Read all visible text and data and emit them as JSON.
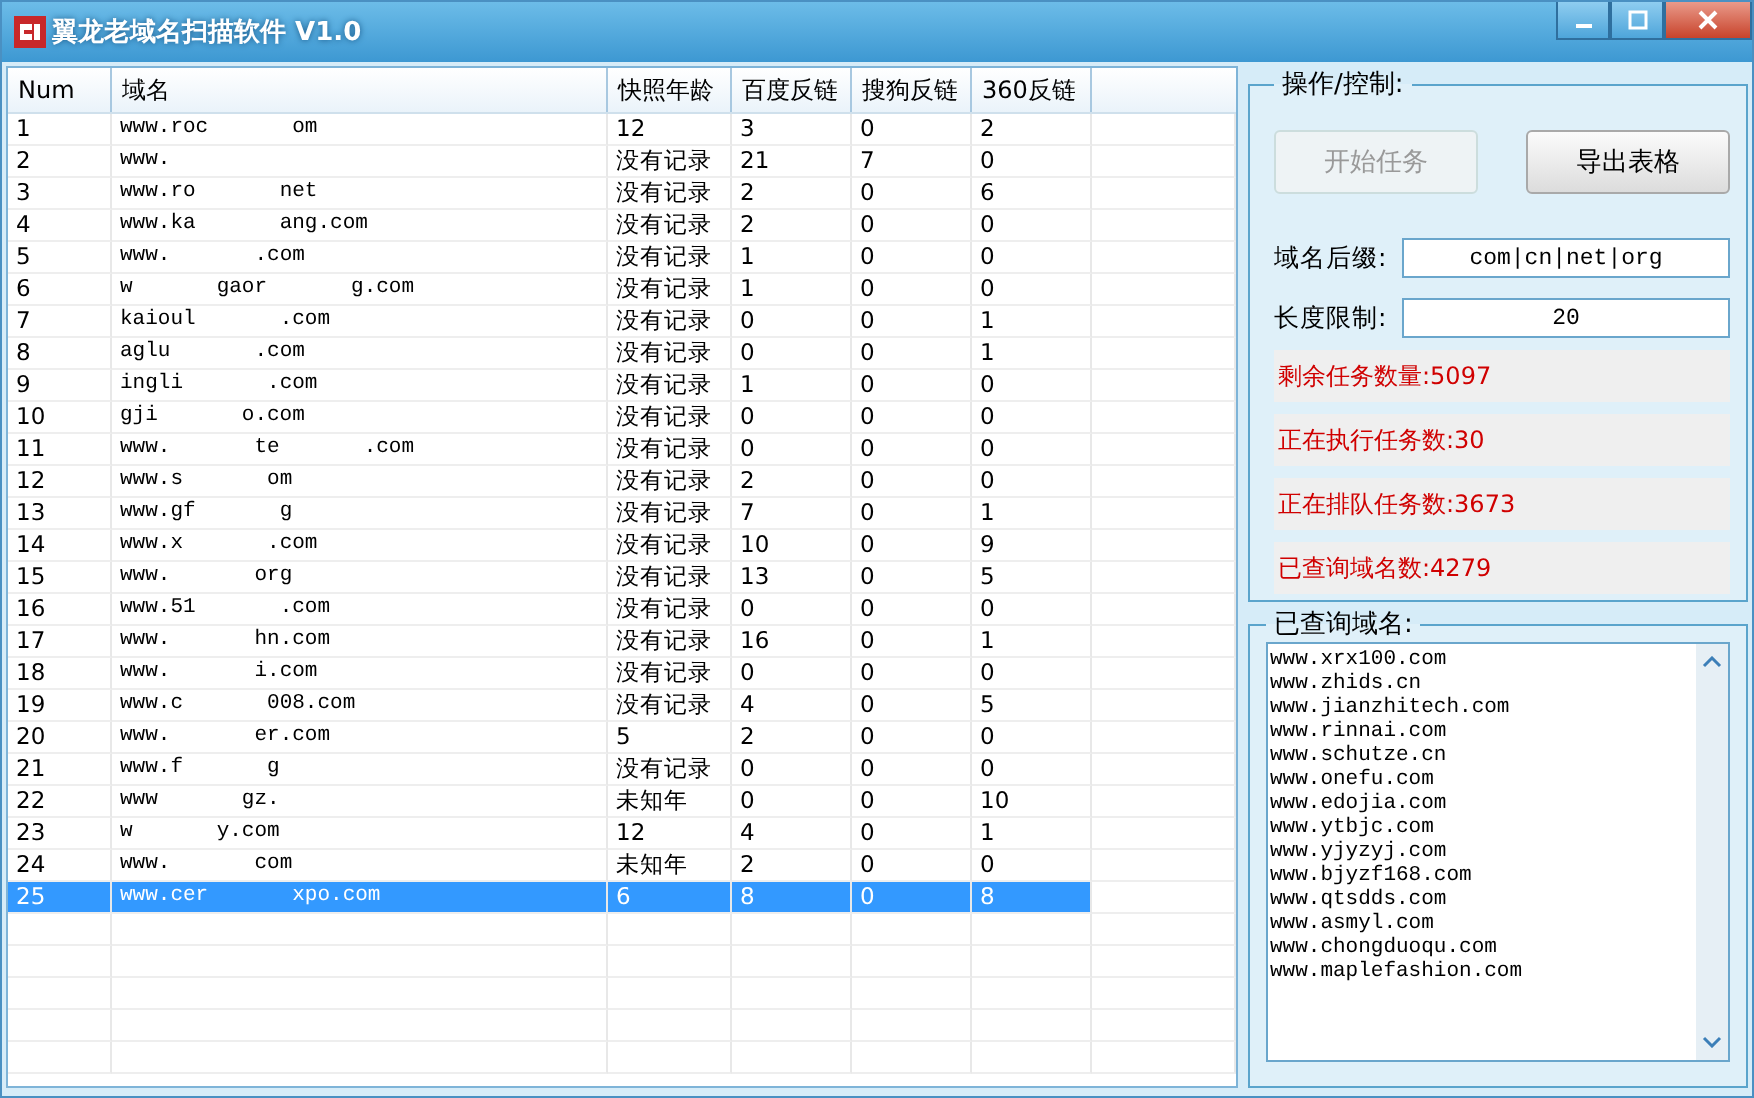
{
  "window": {
    "title": "翼龙老域名扫描软件 V1.0"
  },
  "table": {
    "columns": [
      "Num",
      "域名",
      "快照年龄",
      "百度反链",
      "搜狗反链",
      "360反链"
    ],
    "rows": [
      {
        "num": "1",
        "domain": [
          "www.roc",
          "om"
        ],
        "age": "12",
        "baidu": "3",
        "sogou": "0",
        "so360": "2",
        "selected": false
      },
      {
        "num": "2",
        "domain": [
          "www."
        ],
        "age": "没有记录",
        "baidu": "21",
        "sogou": "7",
        "so360": "0",
        "selected": false
      },
      {
        "num": "3",
        "domain": [
          "www.ro",
          "net"
        ],
        "age": "没有记录",
        "baidu": "2",
        "sogou": "0",
        "so360": "6",
        "selected": false
      },
      {
        "num": "4",
        "domain": [
          "www.ka",
          "ang.com"
        ],
        "age": "没有记录",
        "baidu": "2",
        "sogou": "0",
        "so360": "0",
        "selected": false
      },
      {
        "num": "5",
        "domain": [
          "www.",
          ".com"
        ],
        "age": "没有记录",
        "baidu": "1",
        "sogou": "0",
        "so360": "0",
        "selected": false
      },
      {
        "num": "6",
        "domain": [
          "w",
          "gaor",
          "g.com"
        ],
        "age": "没有记录",
        "baidu": "1",
        "sogou": "0",
        "so360": "0",
        "selected": false
      },
      {
        "num": "7",
        "domain": [
          "kaioul",
          ".com"
        ],
        "age": "没有记录",
        "baidu": "0",
        "sogou": "0",
        "so360": "1",
        "selected": false
      },
      {
        "num": "8",
        "domain": [
          "aglu",
          ".com"
        ],
        "age": "没有记录",
        "baidu": "0",
        "sogou": "0",
        "so360": "1",
        "selected": false
      },
      {
        "num": "9",
        "domain": [
          "ingli",
          ".com"
        ],
        "age": "没有记录",
        "baidu": "1",
        "sogou": "0",
        "so360": "0",
        "selected": false
      },
      {
        "num": "10",
        "domain": [
          "gji",
          "o.com"
        ],
        "age": "没有记录",
        "baidu": "0",
        "sogou": "0",
        "so360": "0",
        "selected": false
      },
      {
        "num": "11",
        "domain": [
          "www.",
          "te",
          ".com"
        ],
        "age": "没有记录",
        "baidu": "0",
        "sogou": "0",
        "so360": "0",
        "selected": false
      },
      {
        "num": "12",
        "domain": [
          "www.s",
          "om"
        ],
        "age": "没有记录",
        "baidu": "2",
        "sogou": "0",
        "so360": "0",
        "selected": false
      },
      {
        "num": "13",
        "domain": [
          "www.gf",
          "g"
        ],
        "age": "没有记录",
        "baidu": "7",
        "sogou": "0",
        "so360": "1",
        "selected": false
      },
      {
        "num": "14",
        "domain": [
          "www.x",
          ".com"
        ],
        "age": "没有记录",
        "baidu": "10",
        "sogou": "0",
        "so360": "9",
        "selected": false
      },
      {
        "num": "15",
        "domain": [
          "www.",
          "org"
        ],
        "age": "没有记录",
        "baidu": "13",
        "sogou": "0",
        "so360": "5",
        "selected": false
      },
      {
        "num": "16",
        "domain": [
          "www.51",
          ".com"
        ],
        "age": "没有记录",
        "baidu": "0",
        "sogou": "0",
        "so360": "0",
        "selected": false
      },
      {
        "num": "17",
        "domain": [
          "www.",
          "hn.com"
        ],
        "age": "没有记录",
        "baidu": "16",
        "sogou": "0",
        "so360": "1",
        "selected": false
      },
      {
        "num": "18",
        "domain": [
          "www.",
          "i.com"
        ],
        "age": "没有记录",
        "baidu": "0",
        "sogou": "0",
        "so360": "0",
        "selected": false
      },
      {
        "num": "19",
        "domain": [
          "www.c",
          "008.com"
        ],
        "age": "没有记录",
        "baidu": "4",
        "sogou": "0",
        "so360": "5",
        "selected": false
      },
      {
        "num": "20",
        "domain": [
          "www.",
          "er.com"
        ],
        "age": "5",
        "baidu": "2",
        "sogou": "0",
        "so360": "0",
        "selected": false
      },
      {
        "num": "21",
        "domain": [
          "www.f",
          "g"
        ],
        "age": "没有记录",
        "baidu": "0",
        "sogou": "0",
        "so360": "0",
        "selected": false
      },
      {
        "num": "22",
        "domain": [
          "www",
          "gz."
        ],
        "age": "未知年",
        "baidu": "0",
        "sogou": "0",
        "so360": "10",
        "selected": false
      },
      {
        "num": "23",
        "domain": [
          "w",
          "y.com"
        ],
        "age": "12",
        "baidu": "4",
        "sogou": "0",
        "so360": "1",
        "selected": false
      },
      {
        "num": "24",
        "domain": [
          "www.",
          "com"
        ],
        "age": "未知年",
        "baidu": "2",
        "sogou": "0",
        "so360": "0",
        "selected": false
      },
      {
        "num": "25",
        "domain": [
          "www.cer",
          "xpo.com"
        ],
        "age": "6",
        "baidu": "8",
        "sogou": "0",
        "so360": "8",
        "selected": true
      }
    ]
  },
  "control": {
    "title": "操作/控制:",
    "buttons": [
      {
        "label": "开始任务",
        "disabled": true
      },
      {
        "label": "导出表格",
        "disabled": false
      }
    ],
    "fields": [
      {
        "label": "域名后缀:",
        "value": "com|cn|net|org"
      },
      {
        "label": "长度限制:",
        "value": "20"
      }
    ],
    "stats": [
      "剩余任务数量:5097",
      "正在执行任务数:30",
      "正在排队任务数:3673",
      "已查询域名数:4279"
    ]
  },
  "log": {
    "title": "已查询域名:",
    "lines": [
      "www.xrx100.com",
      "www.zhids.cn",
      "www.jianzhitech.com",
      "www.rinnai.com",
      "www.schutze.cn",
      "www.onefu.com",
      "www.edojia.com",
      "www.ytbjc.com",
      "www.yjyzyj.com",
      "www.bjyzf168.com",
      "www.qtsdds.com",
      "www.asmyl.com",
      "www.chongduoqu.com",
      "www.maplefashion.com"
    ]
  }
}
